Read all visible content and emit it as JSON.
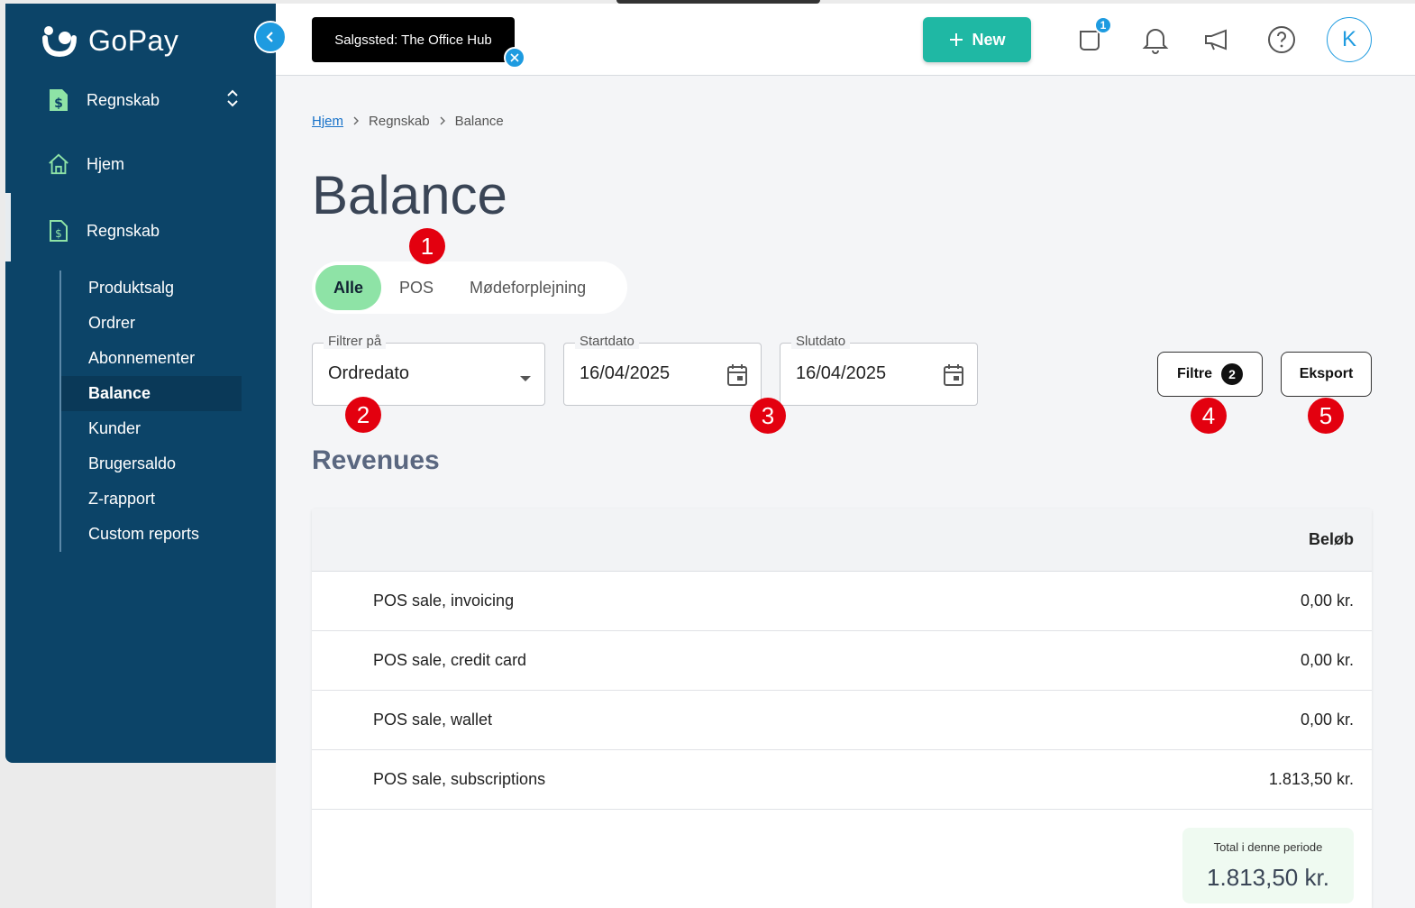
{
  "brand": {
    "name": "GoPay"
  },
  "sidebar": {
    "selector_label": "Regnskab",
    "home_label": "Hjem",
    "section_label": "Regnskab",
    "items": [
      {
        "label": "Produktsalg"
      },
      {
        "label": "Ordrer"
      },
      {
        "label": "Abonnementer"
      },
      {
        "label": "Balance"
      },
      {
        "label": "Kunder"
      },
      {
        "label": "Brugersaldo"
      },
      {
        "label": "Z-rapport"
      },
      {
        "label": "Custom reports"
      }
    ],
    "active_item": "Balance"
  },
  "topbar": {
    "location_chip": "Salgssted: The Office Hub",
    "new_label": "New",
    "orders_badge": "1",
    "avatar_initial": "K"
  },
  "breadcrumb": {
    "home": "Hjem",
    "parent": "Regnskab",
    "current": "Balance"
  },
  "page": {
    "title": "Balance",
    "section_title": "Revenues"
  },
  "tabs": [
    {
      "label": "Alle",
      "active": true
    },
    {
      "label": "POS",
      "active": false
    },
    {
      "label": "Mødeforplejning",
      "active": false
    }
  ],
  "filters": {
    "filter_on": {
      "label": "Filtrer på",
      "value": "Ordredato"
    },
    "start_date": {
      "label": "Startdato",
      "value": "16/04/2025"
    },
    "end_date": {
      "label": "Slutdato",
      "value": "16/04/2025"
    },
    "filters_button": "Filtre",
    "filters_count": "2",
    "export_button": "Eksport"
  },
  "markers": [
    "1",
    "2",
    "3",
    "4",
    "5"
  ],
  "table": {
    "amount_header": "Beløb",
    "rows": [
      {
        "name": "POS sale, invoicing",
        "amount": "0,00 kr."
      },
      {
        "name": "POS sale, credit card",
        "amount": "0,00 kr."
      },
      {
        "name": "POS sale, wallet",
        "amount": "0,00 kr."
      },
      {
        "name": "POS sale, subscriptions",
        "amount": "1.813,50 kr."
      }
    ],
    "total_label": "Total i denne periode",
    "total_value": "1.813,50 kr."
  },
  "colors": {
    "sidebar": "#0c4468",
    "accent": "#1fb8a4",
    "active_tab": "#8ee3a6",
    "marker": "#e3000f",
    "link": "#1a73c9"
  }
}
